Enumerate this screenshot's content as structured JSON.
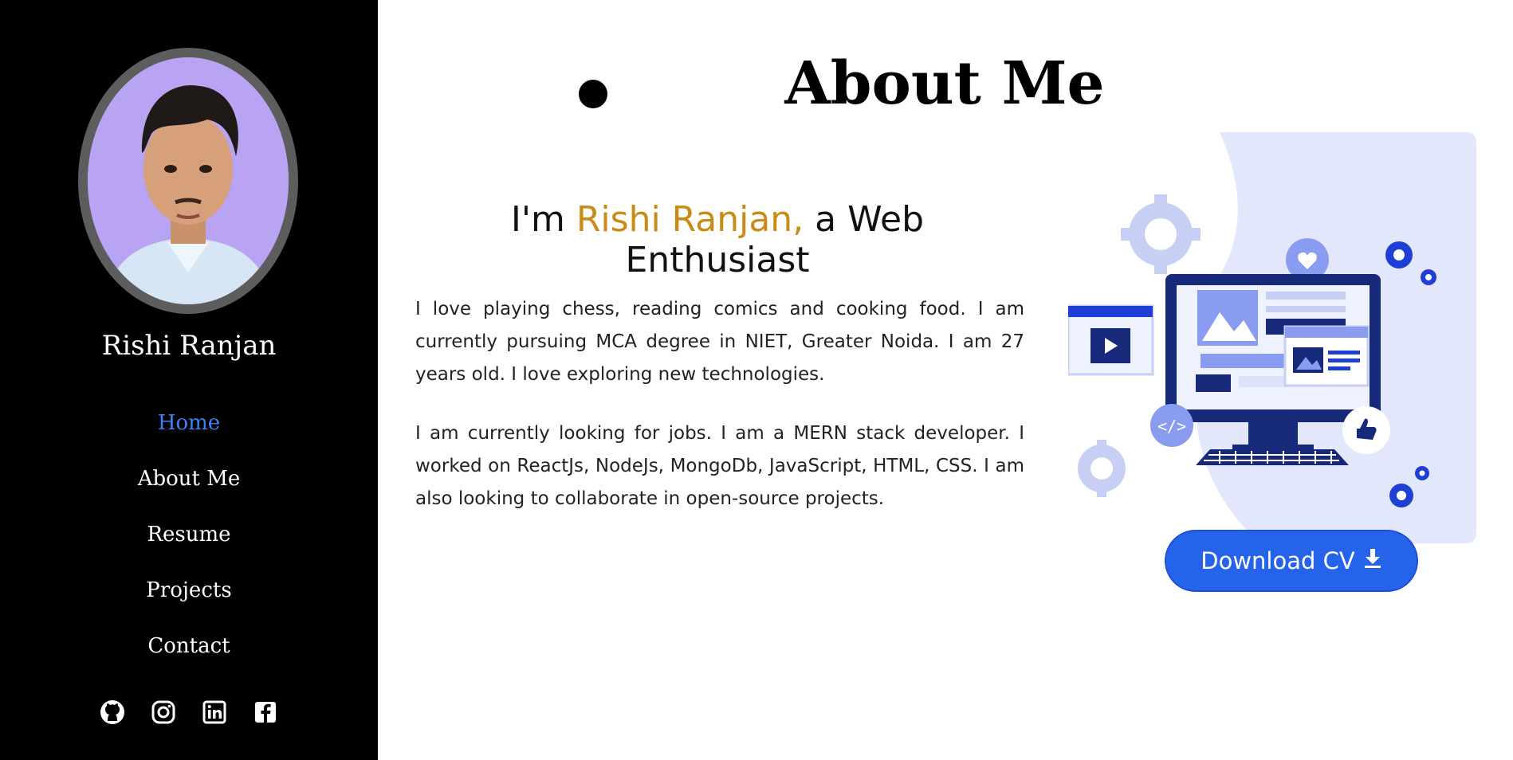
{
  "sidebar": {
    "name": "Rishi Ranjan",
    "nav": [
      {
        "label": "Home",
        "active": true
      },
      {
        "label": "About Me",
        "active": false
      },
      {
        "label": "Resume",
        "active": false
      },
      {
        "label": "Projects",
        "active": false
      },
      {
        "label": "Contact",
        "active": false
      }
    ],
    "socials": [
      "github-icon",
      "instagram-icon",
      "linkedin-icon",
      "facebook-icon"
    ]
  },
  "main": {
    "title": "About Me",
    "headline": {
      "prefix": "I'm ",
      "highlight": "Rishi Ranjan,",
      "suffix": " a Web Enthusiast"
    },
    "bio": [
      "I love playing chess, reading comics and cooking food. I am currently pursuing MCA degree in NIET, Greater Noida. I am 27 years old. I love exploring new technologies.",
      "I am currently looking for jobs. I am a MERN stack developer. I worked on ReactJs, NodeJs, MongoDb, JavaScript, HTML, CSS. I am also looking to collaborate in open-source projects."
    ],
    "download_label": "Download CV"
  },
  "colors": {
    "sidebar_bg": "#000000",
    "active_link": "#3b82f6",
    "highlight": "#c98b14",
    "button": "#2563eb"
  }
}
